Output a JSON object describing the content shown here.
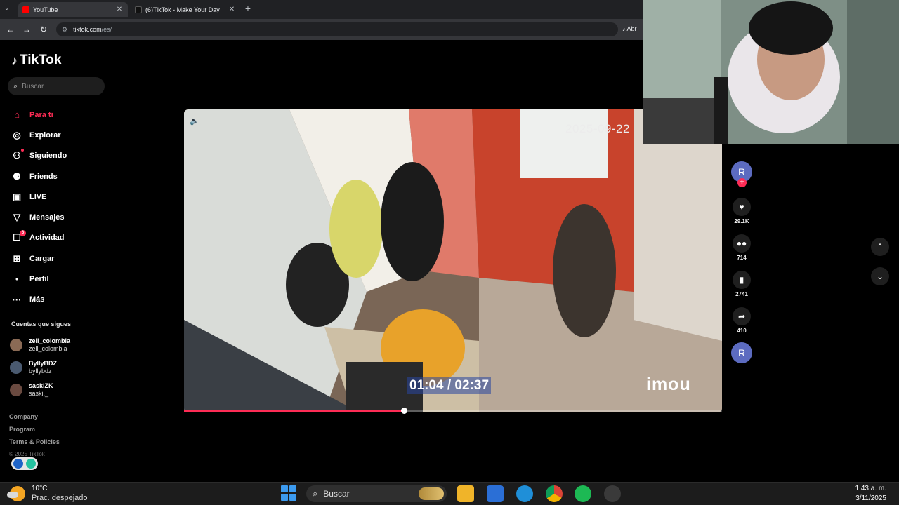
{
  "browser": {
    "tabs": [
      {
        "title": "YouTube",
        "active": true
      },
      {
        "title": "(6)TikTok - Make Your Day",
        "active": false
      }
    ],
    "url_domain": "tiktok.com",
    "url_path": "/es/",
    "extension_label": "Abr"
  },
  "tiktok": {
    "logo": "TikTok",
    "search_placeholder": "Buscar",
    "nav": [
      {
        "label": "Para ti",
        "icon": "home-icon",
        "active": true
      },
      {
        "label": "Explorar",
        "icon": "compass-icon"
      },
      {
        "label": "Siguiendo",
        "icon": "following-icon"
      },
      {
        "label": "Friends",
        "icon": "friends-icon"
      },
      {
        "label": "LIVE",
        "icon": "live-icon"
      },
      {
        "label": "Mensajes",
        "icon": "messages-icon"
      },
      {
        "label": "Actividad",
        "icon": "activity-icon",
        "badge": "6"
      },
      {
        "label": "Cargar",
        "icon": "upload-icon"
      },
      {
        "label": "Perfil",
        "icon": "profile-icon"
      },
      {
        "label": "Más",
        "icon": "more-icon"
      }
    ],
    "following_title": "Cuentas que sigues",
    "following": [
      {
        "name": "zell_colombia",
        "handle": "zell_colombia"
      },
      {
        "name": "ByllyBDZ",
        "handle": "byllybdz"
      },
      {
        "name": "saskiZK",
        "handle": "saski._"
      }
    ],
    "footer": [
      "Company",
      "Program",
      "Terms & Policies"
    ],
    "copyright": "© 2025 TikTok"
  },
  "video": {
    "timestamp_overlay": "2025-09-22",
    "timecode": "01:04 / 02:37",
    "watermark": "imou",
    "progress": 0.409
  },
  "actions": {
    "avatar_letter": "R",
    "likes": "29.1K",
    "comments": "714",
    "saves": "2741",
    "shares": "410",
    "music_avatar_letter": "R"
  },
  "taskbar": {
    "temperature": "10°C",
    "weather": "Prac. despejado",
    "search": "Buscar",
    "time": "1:43 a. m.",
    "date": "3/11/2025"
  },
  "colors": {
    "accent": "#fe2c55",
    "avatar": "#5c6bc0",
    "windows_blue": "#3c9bf0"
  }
}
